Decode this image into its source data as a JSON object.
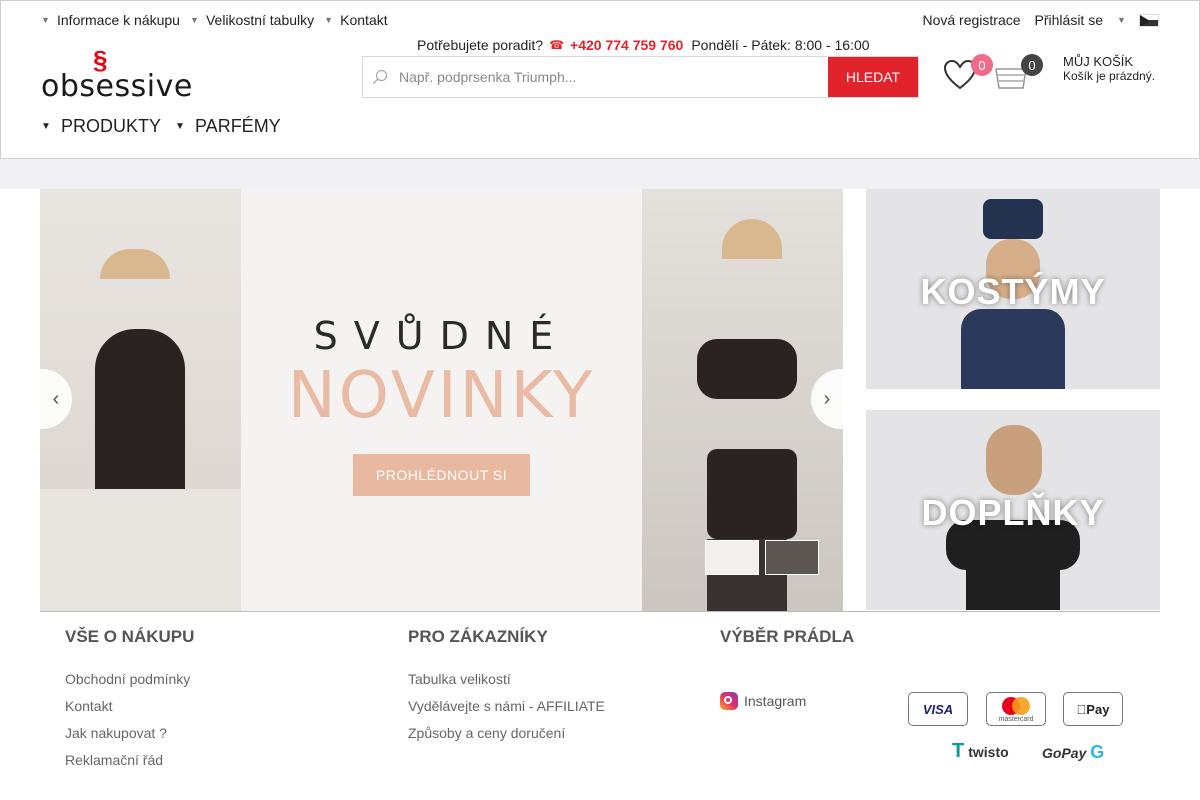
{
  "topnav": {
    "items": [
      "Informace k nákupu",
      "Velikostní tabulky",
      "Kontakt"
    ],
    "register": "Nová registrace",
    "login": "Přihlásit se"
  },
  "logo": {
    "text": "obsessive"
  },
  "help": {
    "question": "Potřebujete poradit?",
    "phone": "+420 774 759 760",
    "hours": "Pondělí - Pátek: 8:00 - 16:00"
  },
  "search": {
    "placeholder": "Např. podprsenka Triumph...",
    "button": "HLEDAT"
  },
  "wishlist": {
    "count": "0"
  },
  "cart": {
    "count": "0",
    "title": "MŮJ KOŠÍK",
    "status": "Košík je prázdný."
  },
  "mainnav": {
    "items": [
      "PRODUKTY",
      "PARFÉMY"
    ]
  },
  "hero": {
    "line1": "SVŮDNÉ",
    "line2": "NOVINKY",
    "cta": "PROHLÉDNOUT SI"
  },
  "promos": [
    {
      "label": "KOSTÝMY"
    },
    {
      "label": "DOPLŇKY"
    }
  ],
  "footer": {
    "col1": {
      "title": "VŠE O NÁKUPU",
      "links": [
        "Obchodní podmínky",
        "Kontakt",
        "Jak nakupovat ?",
        "Reklamační řád"
      ]
    },
    "col2": {
      "title": "PRO ZÁKAZNÍKY",
      "links": [
        "Tabulka velikostí",
        "Vydělávejte s námi - AFFILIATE",
        "Způsoby a ceny doručení"
      ]
    },
    "col3": {
      "title": "VÝBĚR PRÁDLA",
      "instagram": "Instagram"
    }
  },
  "payments": {
    "visa": "VISA",
    "mastercard": "mastercard",
    "applepay": "Pay",
    "twisto": "twisto",
    "gopay": "GoPay"
  },
  "colors": {
    "accent": "#e2232c",
    "cta": "#e9b8a0",
    "novinky": "#e9bba4"
  }
}
